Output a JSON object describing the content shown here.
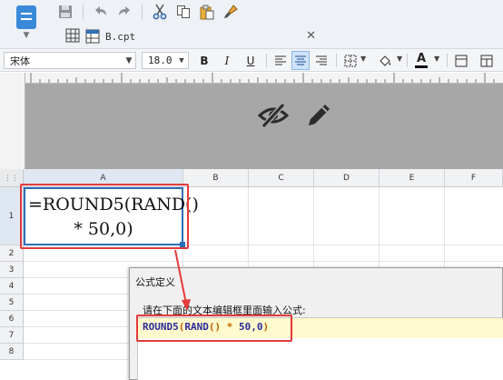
{
  "toolbar": {
    "tab_file_name": "B.cpt",
    "font_name": "宋体",
    "font_size": "18.0",
    "bold": "B",
    "italic": "I",
    "underline": "U",
    "font_color_letter": "A"
  },
  "sheet": {
    "columns": [
      "A",
      "B",
      "C",
      "D",
      "E",
      "F"
    ],
    "rows": [
      "1",
      "2",
      "3",
      "4",
      "5",
      "6",
      "7",
      "8"
    ],
    "cell_a1_line1": "=ROUND5(RAND()",
    "cell_a1_line2": "* 50,0)"
  },
  "dialog": {
    "title": "公式定义",
    "prompt": "请在下面的文本编辑框里面输入公式:",
    "formula_parts": {
      "fn1": "ROUND5",
      "open1": "(",
      "fn2": "RAND",
      "paren2": "()",
      "op": " * ",
      "num1": "50",
      "comma": ",",
      "num2": "0",
      "close1": ")"
    }
  },
  "colors": {
    "accent_blue": "#2f6fb5",
    "highlight_red": "#e53b3b",
    "editor_line": "#fffacd",
    "design_gray": "#a7a7a7"
  },
  "icons": {
    "app_menu": "document-icon",
    "save": "save-icon",
    "undo": "undo-icon",
    "redo": "redo-icon",
    "cut": "cut-icon",
    "copy": "copy-icon",
    "paste": "paste-icon",
    "format_painter": "brush-icon",
    "hidden": "eye-slash-icon",
    "edit": "pencil-icon"
  }
}
